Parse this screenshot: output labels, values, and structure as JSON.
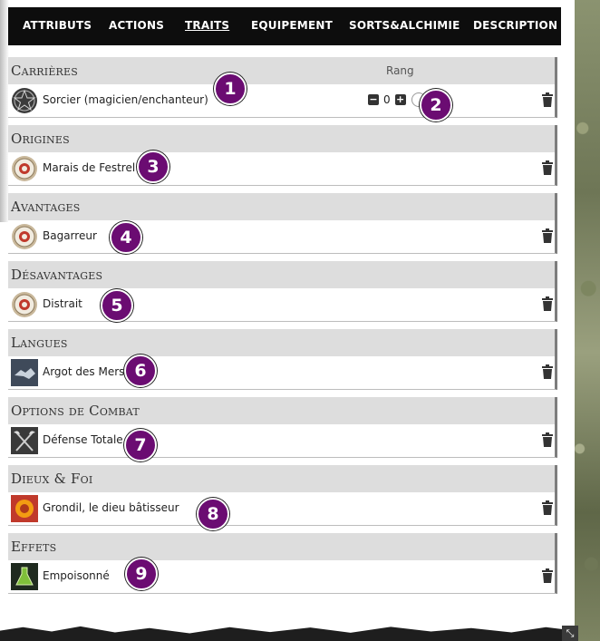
{
  "nav": {
    "tabs": [
      "ATTRIBUTS",
      "ACTIONS",
      "TRAITS",
      "EQUIPEMENT",
      "SORTS&ALCHIMIE",
      "DESCRIPTION"
    ],
    "active": "TRAITS"
  },
  "sections": {
    "carrieres": {
      "title": "Carrières",
      "rank_header": "Rang",
      "item": "Sorcier (magicien/enchanteur)",
      "rank_value": "0"
    },
    "origines": {
      "title": "Origines",
      "item": "Marais de Festrel"
    },
    "avantages": {
      "title": "Avantages",
      "item": "Bagarreur"
    },
    "desavantages": {
      "title": "Désavantages",
      "item": "Distrait"
    },
    "langues": {
      "title": "Langues",
      "item": "Argot des Mers"
    },
    "options": {
      "title": "Options de Combat",
      "item": "Défense Totale"
    },
    "dieux": {
      "title": "Dieux & Foi",
      "item": "Grondil, le dieu bâtisseur"
    },
    "effets": {
      "title": "Effets",
      "item": "Empoisonné"
    }
  },
  "badges": [
    "1",
    "2",
    "3",
    "4",
    "5",
    "6",
    "7",
    "8",
    "9"
  ],
  "icons": {
    "carrieres": "pentagram-icon",
    "origines": "origin-emblem-icon",
    "avantages": "origin-emblem-icon",
    "desavantages": "origin-emblem-icon",
    "langues": "handshake-icon",
    "options": "crossed-axes-icon",
    "dieux": "sun-flower-icon",
    "effets": "potion-flask-icon"
  },
  "colors": {
    "nav_bg": "#0d0d0d",
    "section_bg": "#dddddd",
    "badge": "#6b0c72"
  }
}
